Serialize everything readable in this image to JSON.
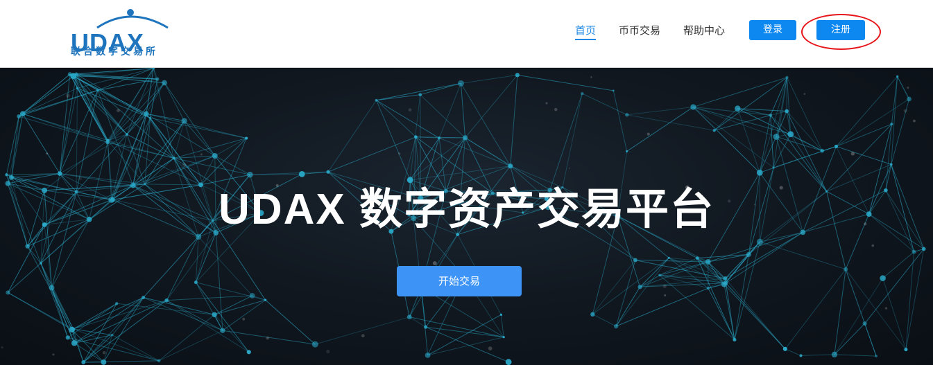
{
  "header": {
    "logo": {
      "text": "UDAX",
      "subtitle": "联合数字交易所"
    },
    "nav": {
      "home": "首页",
      "trade": "币币交易",
      "help": "帮助中心"
    },
    "login_label": "登录",
    "register_label": "注册"
  },
  "hero": {
    "title": "UDAX 数字资产交易平台",
    "cta_label": "开始交易"
  },
  "colors": {
    "brand": "#1e74bd",
    "accent": "#0c88f0",
    "cta": "#3d94f6",
    "highlight": "#e8161b",
    "hero_bg": "#111820",
    "network": "#2aa9c9"
  },
  "icons": {
    "logo_arc": "logo-arc-icon",
    "network": "network-background"
  }
}
